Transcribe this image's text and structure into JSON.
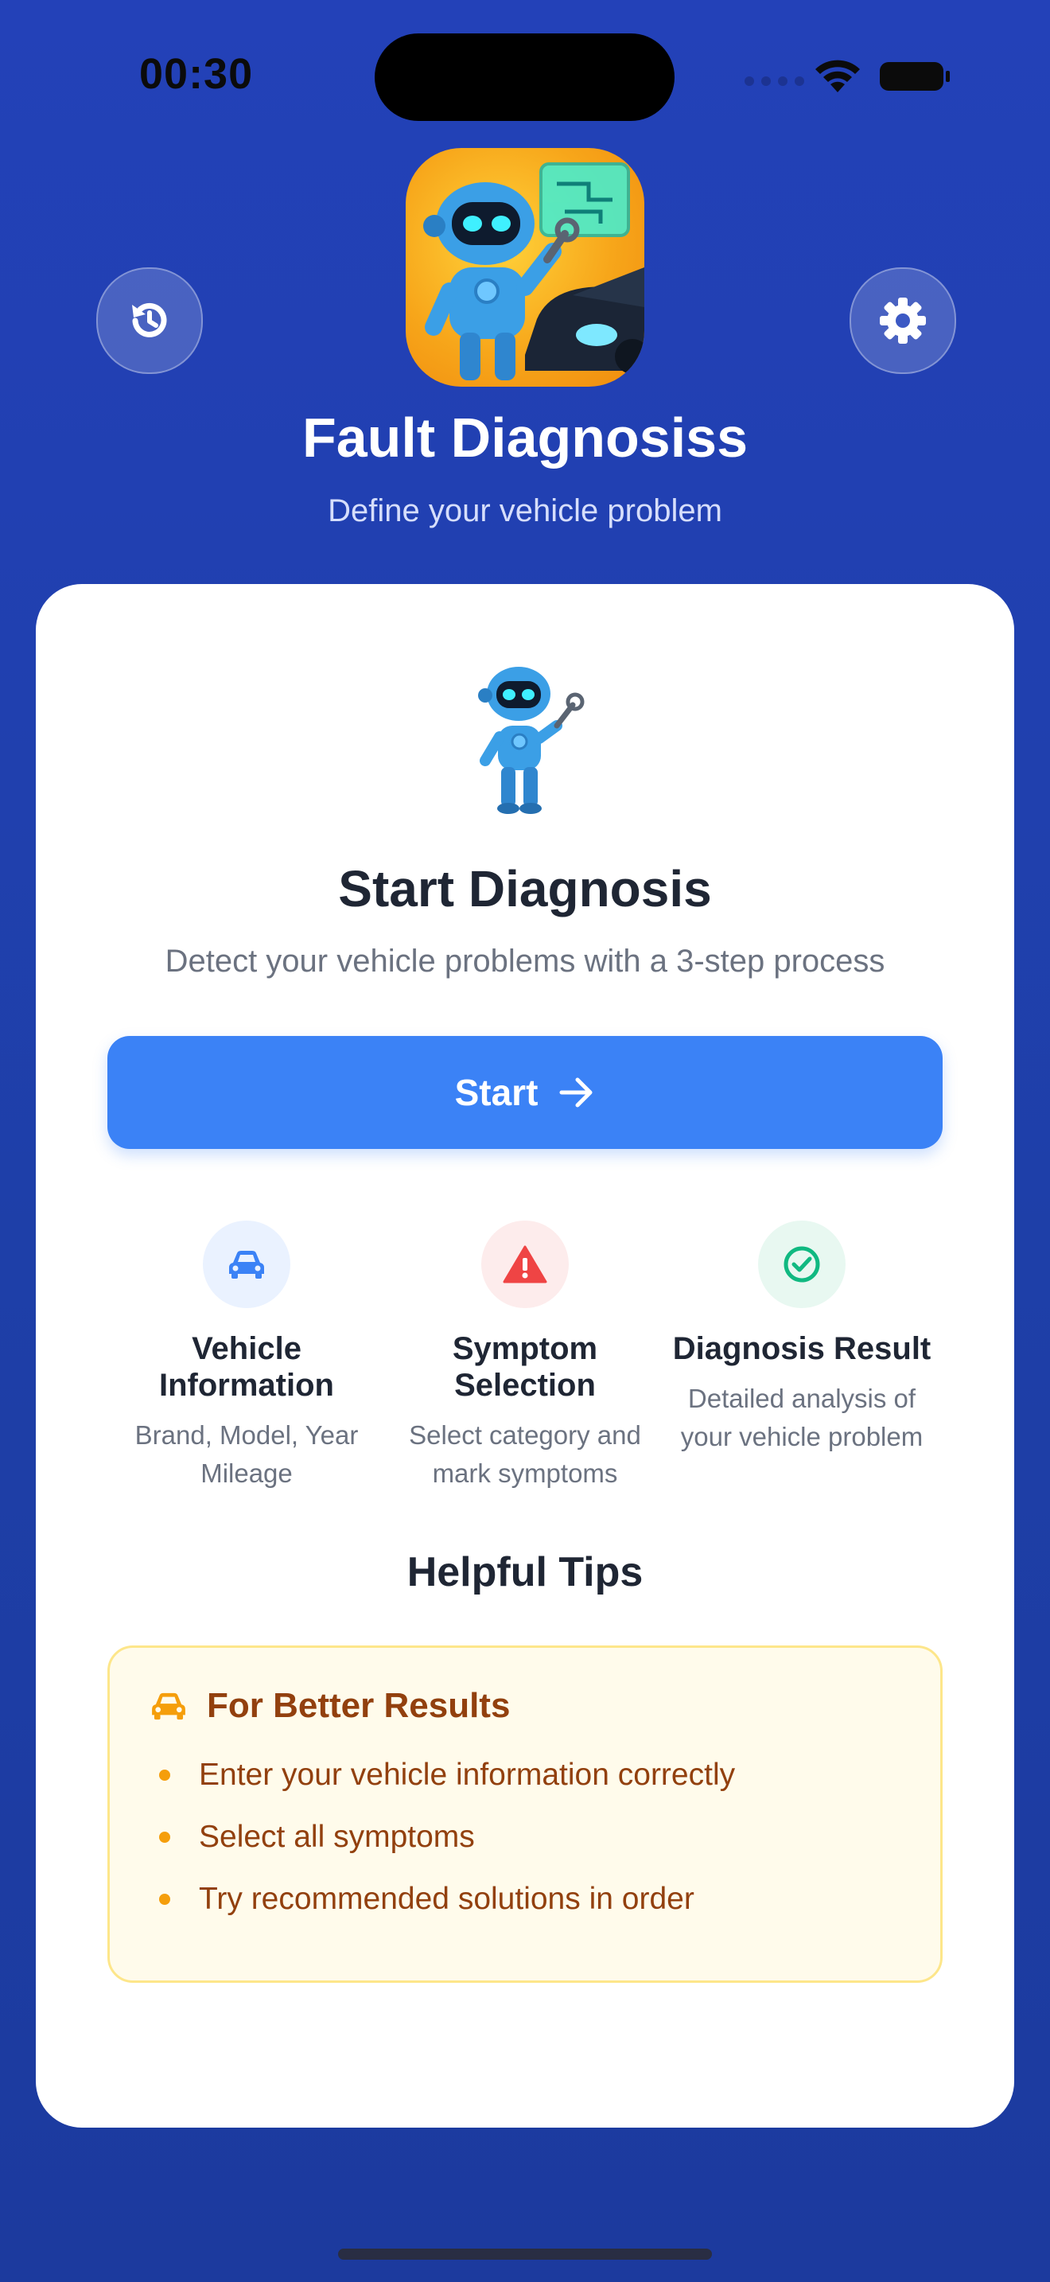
{
  "status": {
    "time": "00:30"
  },
  "header": {
    "title": "Fault Diagnosiss",
    "subtitle": "Define your vehicle problem"
  },
  "card": {
    "title": "Start Diagnosis",
    "description": "Detect your vehicle problems with a 3-step process",
    "start_label": "Start",
    "steps": [
      {
        "title": "Vehicle Information",
        "desc": "Brand, Model, Year Mileage",
        "icon": "car-icon",
        "color": "#3b82f6"
      },
      {
        "title": "Symptom Selection",
        "desc": "Select category and mark symptoms",
        "icon": "warning-icon",
        "color": "#ef4444"
      },
      {
        "title": "Diagnosis Result",
        "desc": "Detailed analysis of your vehicle problem",
        "icon": "check-circle-icon",
        "color": "#10b981"
      }
    ]
  },
  "tips": {
    "title": "Helpful Tips",
    "box_title": "For Better Results",
    "items": [
      "Enter your vehicle information correctly",
      "Select all symptoms",
      "Try recommended solutions in order"
    ]
  },
  "colors": {
    "accent": "#3b82f6",
    "background": "#2341b8",
    "tips_text": "#92400e"
  }
}
